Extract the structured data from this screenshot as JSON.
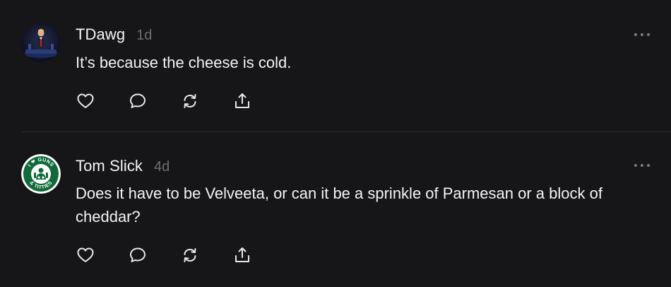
{
  "posts": [
    {
      "username": "TDawg",
      "time": "1d",
      "text": "It’s because the cheese is cold.",
      "avatar_icon": "user-photo-avatar",
      "actions": [
        "like-icon",
        "reply-icon",
        "repost-icon",
        "share-icon"
      ]
    },
    {
      "username": "Tom Slick",
      "time": "4d",
      "text": "Does it have to be Velveeta, or can it be a sprinkle of Parmesan or a block of cheddar?",
      "avatar_icon": "green-badge-avatar",
      "avatar_text_top": "I ❤ GUNS",
      "avatar_text_bottom": "& TITTIES",
      "actions": [
        "like-icon",
        "reply-icon",
        "repost-icon",
        "share-icon"
      ]
    }
  ],
  "colors": {
    "background": "#161618",
    "text": "#f3f3f5",
    "muted": "#6d6d72",
    "divider": "#2e2e31",
    "badge_green": "#0f6b3a"
  }
}
